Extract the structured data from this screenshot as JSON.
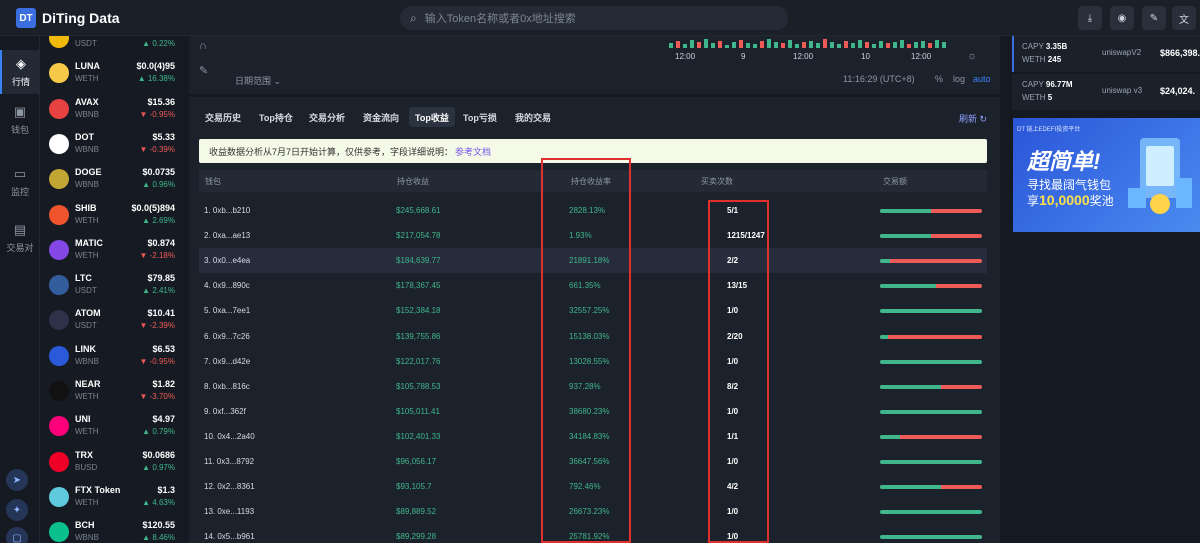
{
  "app": {
    "logo": "DT",
    "name": "DiTing Data"
  },
  "search": {
    "placeholder": "输入Token名称或者0x地址搜索",
    "icon": "search-icon"
  },
  "top_buttons": [
    {
      "icon": "download-icon",
      "glyph": "⤓"
    },
    {
      "icon": "gas-icon",
      "glyph": "◉"
    },
    {
      "icon": "edit-icon",
      "glyph": "✎"
    },
    {
      "icon": "translate-icon",
      "glyph": "文"
    }
  ],
  "left_nav": [
    {
      "label": "行情",
      "icon": "layers-icon",
      "glyph": "◈",
      "active": true
    },
    {
      "label": "钱包",
      "icon": "wallet-icon",
      "glyph": "▣",
      "active": false
    },
    {
      "label": "监控",
      "icon": "monitor-icon",
      "glyph": "▭",
      "active": false
    },
    {
      "label": "交易对",
      "icon": "ticket-icon",
      "glyph": "▤",
      "active": false
    }
  ],
  "social": [
    {
      "icon": "telegram-icon",
      "glyph": "➤"
    },
    {
      "icon": "twitter-icon",
      "glyph": "✦"
    },
    {
      "icon": "discord-icon",
      "glyph": "▢"
    }
  ],
  "tokens": [
    {
      "symbol": "",
      "quote": "USDT",
      "price": "",
      "change": "0.22%",
      "dir": "up",
      "color": "#f0b90b"
    },
    {
      "symbol": "LUNA",
      "quote": "WETH",
      "price": "$0.0(4)95",
      "change": "16.38%",
      "dir": "up",
      "color": "#f7c948"
    },
    {
      "symbol": "AVAX",
      "quote": "WBNB",
      "price": "$15.36",
      "change": "-0.95%",
      "dir": "dn",
      "color": "#e84142"
    },
    {
      "symbol": "DOT",
      "quote": "WBNB",
      "price": "$5.33",
      "change": "-0.39%",
      "dir": "dn",
      "color": "#ffffff"
    },
    {
      "symbol": "DOGE",
      "quote": "WBNB",
      "price": "$0.0735",
      "change": "0.96%",
      "dir": "up",
      "color": "#c2a633"
    },
    {
      "symbol": "SHIB",
      "quote": "WETH",
      "price": "$0.0(5)894",
      "change": "2.69%",
      "dir": "up",
      "color": "#f0542d"
    },
    {
      "symbol": "MATIC",
      "quote": "WETH",
      "price": "$0.874",
      "change": "-2.18%",
      "dir": "dn",
      "color": "#8247e5"
    },
    {
      "symbol": "LTC",
      "quote": "USDT",
      "price": "$79.85",
      "change": "2.41%",
      "dir": "up",
      "color": "#345d9d"
    },
    {
      "symbol": "ATOM",
      "quote": "USDT",
      "price": "$10.41",
      "change": "-2.39%",
      "dir": "dn",
      "color": "#2e3148"
    },
    {
      "symbol": "LINK",
      "quote": "WBNB",
      "price": "$6.53",
      "change": "-0.95%",
      "dir": "dn",
      "color": "#2a5ada"
    },
    {
      "symbol": "NEAR",
      "quote": "WETH",
      "price": "$1.82",
      "change": "-3.70%",
      "dir": "dn",
      "color": "#111111"
    },
    {
      "symbol": "UNI",
      "quote": "WETH",
      "price": "$4.97",
      "change": "0.79%",
      "dir": "up",
      "color": "#ff007a"
    },
    {
      "symbol": "TRX",
      "quote": "BUSD",
      "price": "$0.0686",
      "change": "0.97%",
      "dir": "up",
      "color": "#ef0027"
    },
    {
      "symbol": "FTX Token",
      "quote": "WETH",
      "price": "$1.3",
      "change": "4.63%",
      "dir": "up",
      "color": "#5fcade"
    },
    {
      "symbol": "BCH",
      "quote": "WBNB",
      "price": "$120.55",
      "change": "8.46%",
      "dir": "up",
      "color": "#0ac18e"
    }
  ],
  "chart": {
    "time_labels": [
      "12:00",
      "9",
      "12:00",
      "10",
      "12:00"
    ],
    "range_label": "日期范围",
    "clock": "11:16:29 (UTC+8)",
    "pct": "%",
    "log": "log",
    "auto": "auto"
  },
  "tabs": [
    "交易历史",
    "Top持仓",
    "交易分析",
    "资金流向",
    "Top收益",
    "Top亏损",
    "我的交易"
  ],
  "active_tab": 4,
  "refresh_label": "刷新",
  "notice": {
    "text": "收益数据分析从7月7日开始计算，仅供参考，字段详细说明：",
    "link": "参考文档"
  },
  "columns": [
    "钱包",
    "持仓收益",
    "持仓收益率",
    "买卖次数",
    "交易额"
  ],
  "rows": [
    {
      "wallet": "1. 0xb...b210",
      "profit": "$245,668.61",
      "rate": "2828.13%",
      "trades": "5/1",
      "buy_share": 0.5
    },
    {
      "wallet": "2. 0xa...ae13",
      "profit": "$217,054.78",
      "rate": "1.93%",
      "trades": "1215/1247",
      "buy_share": 0.5
    },
    {
      "wallet": "3. 0x0...e4ea",
      "profit": "$184,639.77",
      "rate": "21891.18%",
      "trades": "2/2",
      "buy_share": 0.1
    },
    {
      "wallet": "4. 0x9...890c",
      "profit": "$178,367.45",
      "rate": "661.35%",
      "trades": "13/15",
      "buy_share": 0.55
    },
    {
      "wallet": "5. 0xa...7ee1",
      "profit": "$152,384.18",
      "rate": "32557.25%",
      "trades": "1/0",
      "buy_share": 1.0
    },
    {
      "wallet": "6. 0x9...7c26",
      "profit": "$139,755.86",
      "rate": "15138.03%",
      "trades": "2/20",
      "buy_share": 0.08
    },
    {
      "wallet": "7. 0x9...d42e",
      "profit": "$122,017.76",
      "rate": "13028.55%",
      "trades": "1/0",
      "buy_share": 1.0
    },
    {
      "wallet": "8. 0xb...816c",
      "profit": "$105,788.53",
      "rate": "937.28%",
      "trades": "8/2",
      "buy_share": 0.6
    },
    {
      "wallet": "9. 0xf...362f",
      "profit": "$105,011.41",
      "rate": "38680.23%",
      "trades": "1/0",
      "buy_share": 1.0
    },
    {
      "wallet": "10. 0x4...2a40",
      "profit": "$102,401.33",
      "rate": "34184.83%",
      "trades": "1/1",
      "buy_share": 0.2
    },
    {
      "wallet": "11. 0x3...8792",
      "profit": "$96,056.17",
      "rate": "36647.56%",
      "trades": "1/0",
      "buy_share": 1.0
    },
    {
      "wallet": "12. 0x2...8361",
      "profit": "$93,105.7",
      "rate": "792.46%",
      "trades": "4/2",
      "buy_share": 0.6
    },
    {
      "wallet": "13. 0xe...1193",
      "profit": "$89,889.52",
      "rate": "26673.23%",
      "trades": "1/0",
      "buy_share": 1.0
    },
    {
      "wallet": "14. 0x5...b961",
      "profit": "$89,299.28",
      "rate": "25781.92%",
      "trades": "1/0",
      "buy_share": 1.0
    }
  ],
  "pools": [
    {
      "base": "CAPY",
      "base_amt": "3.35B",
      "quote": "WETH",
      "quote_amt": "245",
      "dex": "uniswapV2",
      "value": "$866,398."
    },
    {
      "base": "CAPY",
      "base_amt": "96.77M",
      "quote": "WETH",
      "quote_amt": "5",
      "dex": "uniswap v3",
      "value": "$24,024."
    }
  ],
  "ad": {
    "header": "DT 链上EDEFI投资平台",
    "title": "超简单!",
    "line1": "寻找最阔气钱包",
    "line2_pre": "享",
    "line2_amount": "10,0000",
    "line2_post": "奖池"
  },
  "colors": {
    "up": "#3fb68b",
    "down": "#ee5a55",
    "accent": "#3b82f6",
    "highlight_box": "#e0302d"
  }
}
